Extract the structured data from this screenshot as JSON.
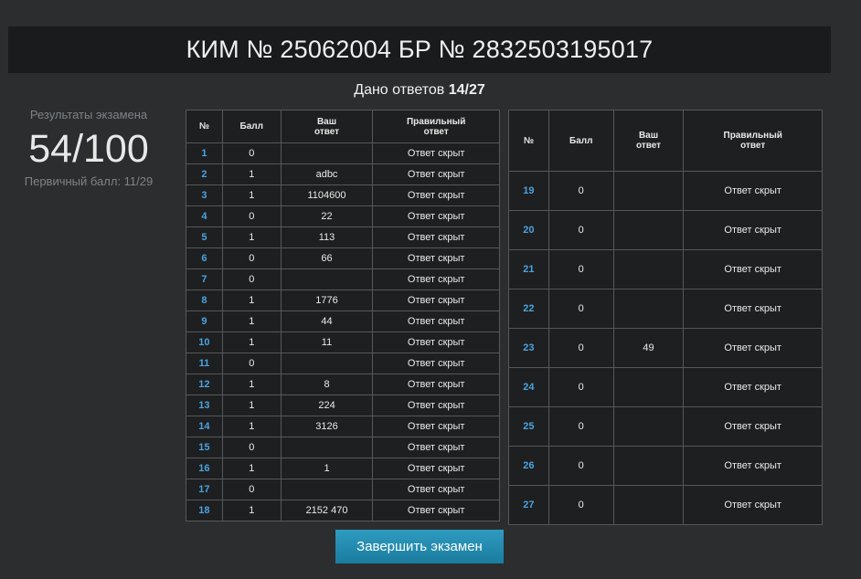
{
  "header": {
    "title": "КИМ № 25062004 БР № 2832503195017"
  },
  "summary": {
    "answers_label": "Дано ответов",
    "answers_value": "14/27"
  },
  "results": {
    "label": "Результаты экзамена",
    "score": "54/100",
    "primary": "Первичный балл: 11/29"
  },
  "table": {
    "col_num": "№",
    "col_score": "Балл",
    "col_answer_l1": "Ваш",
    "col_answer_l2": "ответ",
    "col_correct_l1": "Правильный",
    "col_correct_l2": "ответ"
  },
  "rows_left": [
    {
      "n": "1",
      "score": "0",
      "answer": "",
      "correct": "Ответ скрыт"
    },
    {
      "n": "2",
      "score": "1",
      "answer": "adbc",
      "correct": "Ответ скрыт"
    },
    {
      "n": "3",
      "score": "1",
      "answer": "1104600",
      "correct": "Ответ скрыт"
    },
    {
      "n": "4",
      "score": "0",
      "answer": "22",
      "correct": "Ответ скрыт"
    },
    {
      "n": "5",
      "score": "1",
      "answer": "113",
      "correct": "Ответ скрыт"
    },
    {
      "n": "6",
      "score": "0",
      "answer": "66",
      "correct": "Ответ скрыт"
    },
    {
      "n": "7",
      "score": "0",
      "answer": "",
      "correct": "Ответ скрыт"
    },
    {
      "n": "8",
      "score": "1",
      "answer": "1776",
      "correct": "Ответ скрыт"
    },
    {
      "n": "9",
      "score": "1",
      "answer": "44",
      "correct": "Ответ скрыт"
    },
    {
      "n": "10",
      "score": "1",
      "answer": "11",
      "correct": "Ответ скрыт"
    },
    {
      "n": "11",
      "score": "0",
      "answer": "",
      "correct": "Ответ скрыт"
    },
    {
      "n": "12",
      "score": "1",
      "answer": "8",
      "correct": "Ответ скрыт"
    },
    {
      "n": "13",
      "score": "1",
      "answer": "224",
      "correct": "Ответ скрыт"
    },
    {
      "n": "14",
      "score": "1",
      "answer": "3126",
      "correct": "Ответ скрыт"
    },
    {
      "n": "15",
      "score": "0",
      "answer": "",
      "correct": "Ответ скрыт"
    },
    {
      "n": "16",
      "score": "1",
      "answer": "1",
      "correct": "Ответ скрыт"
    },
    {
      "n": "17",
      "score": "0",
      "answer": "",
      "correct": "Ответ скрыт"
    },
    {
      "n": "18",
      "score": "1",
      "answer": "2152 470",
      "correct": "Ответ скрыт"
    }
  ],
  "rows_right": [
    {
      "n": "19",
      "score": "0",
      "answer": "",
      "correct": "Ответ скрыт"
    },
    {
      "n": "20",
      "score": "0",
      "answer": "",
      "correct": "Ответ скрыт"
    },
    {
      "n": "21",
      "score": "0",
      "answer": "",
      "correct": "Ответ скрыт"
    },
    {
      "n": "22",
      "score": "0",
      "answer": "",
      "correct": "Ответ скрыт"
    },
    {
      "n": "23",
      "score": "0",
      "answer": "49",
      "correct": "Ответ скрыт"
    },
    {
      "n": "24",
      "score": "0",
      "answer": "",
      "correct": "Ответ скрыт"
    },
    {
      "n": "25",
      "score": "0",
      "answer": "",
      "correct": "Ответ скрыт"
    },
    {
      "n": "26",
      "score": "0",
      "answer": "",
      "correct": "Ответ скрыт"
    },
    {
      "n": "27",
      "score": "0",
      "answer": "",
      "correct": "Ответ скрыт"
    }
  ],
  "finish_button": {
    "label": "Завершить экзамен"
  }
}
